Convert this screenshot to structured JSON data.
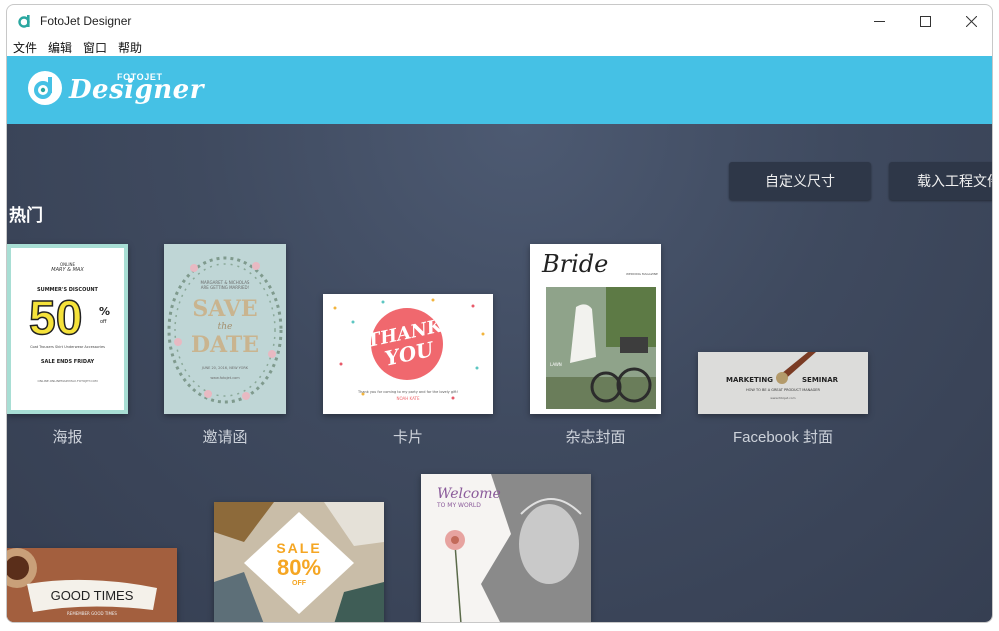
{
  "window": {
    "title": "FotoJet Designer",
    "controls": {
      "minimize_icon": "minimize-icon",
      "maximize_icon": "maximize-icon",
      "close_icon": "close-icon"
    }
  },
  "menubar": {
    "items": [
      "文件",
      "编辑",
      "窗口",
      "帮助"
    ]
  },
  "brand": {
    "name": "Designer",
    "small": "FOTOJET",
    "color": "#45c1e5"
  },
  "toolbar": {
    "custom_size": "自定义尺寸",
    "load_project": "载入工程文件"
  },
  "section": {
    "title": "热门"
  },
  "templates": [
    {
      "label": "海报",
      "texts": {
        "line1": "ONLINE",
        "line2": "MARY & MAX",
        "headline": "SUMMER'S DISCOUNT",
        "big": "50",
        "pct": "%",
        "off": "off",
        "cats": "Coat   Trousers   Skirt   Underwear   Accessories",
        "ends": "SALE ENDS FRIDAY",
        "url": "ONLINE.ONLINEMARYMAX.FOTOJET.COM"
      }
    },
    {
      "label": "邀请函",
      "texts": {
        "names": "MARGARET & NICHOLAS",
        "getting": "ARE GETTING MARRIED!",
        "save": "SAVE",
        "the": "the",
        "date": "DATE",
        "when": "JUNE 20, 2016, NEW YORK",
        "url": "www.fotojet.com"
      }
    },
    {
      "label": "卡片",
      "texts": {
        "thank": "THANK",
        "you": "YOU",
        "msg": "Thank you for coming to my party and for the lovely gift!",
        "sign": "NOAH KATE"
      }
    },
    {
      "label": "杂志封面",
      "texts": {
        "title": "Bride",
        "lawn": "LAWN",
        "side": "WEDDING MAGAZINE"
      }
    },
    {
      "label": "Facebook 封面",
      "texts": {
        "left": "MARKETING",
        "right": "SEMINAR",
        "sub": "HOW TO BE A GREAT PRODUCT MANAGER",
        "url": "www.fotojet.com"
      }
    },
    {
      "label": "",
      "texts": {
        "headline": "GOOD TIMES",
        "sub": "REMEMBER GOOD TIMES"
      }
    },
    {
      "label": "",
      "texts": {
        "sale": "SALE",
        "pct": "80%",
        "off": "OFF"
      }
    },
    {
      "label": "",
      "texts": {
        "welcome": "Welcome",
        "sub": "TO MY WORLD"
      }
    }
  ]
}
